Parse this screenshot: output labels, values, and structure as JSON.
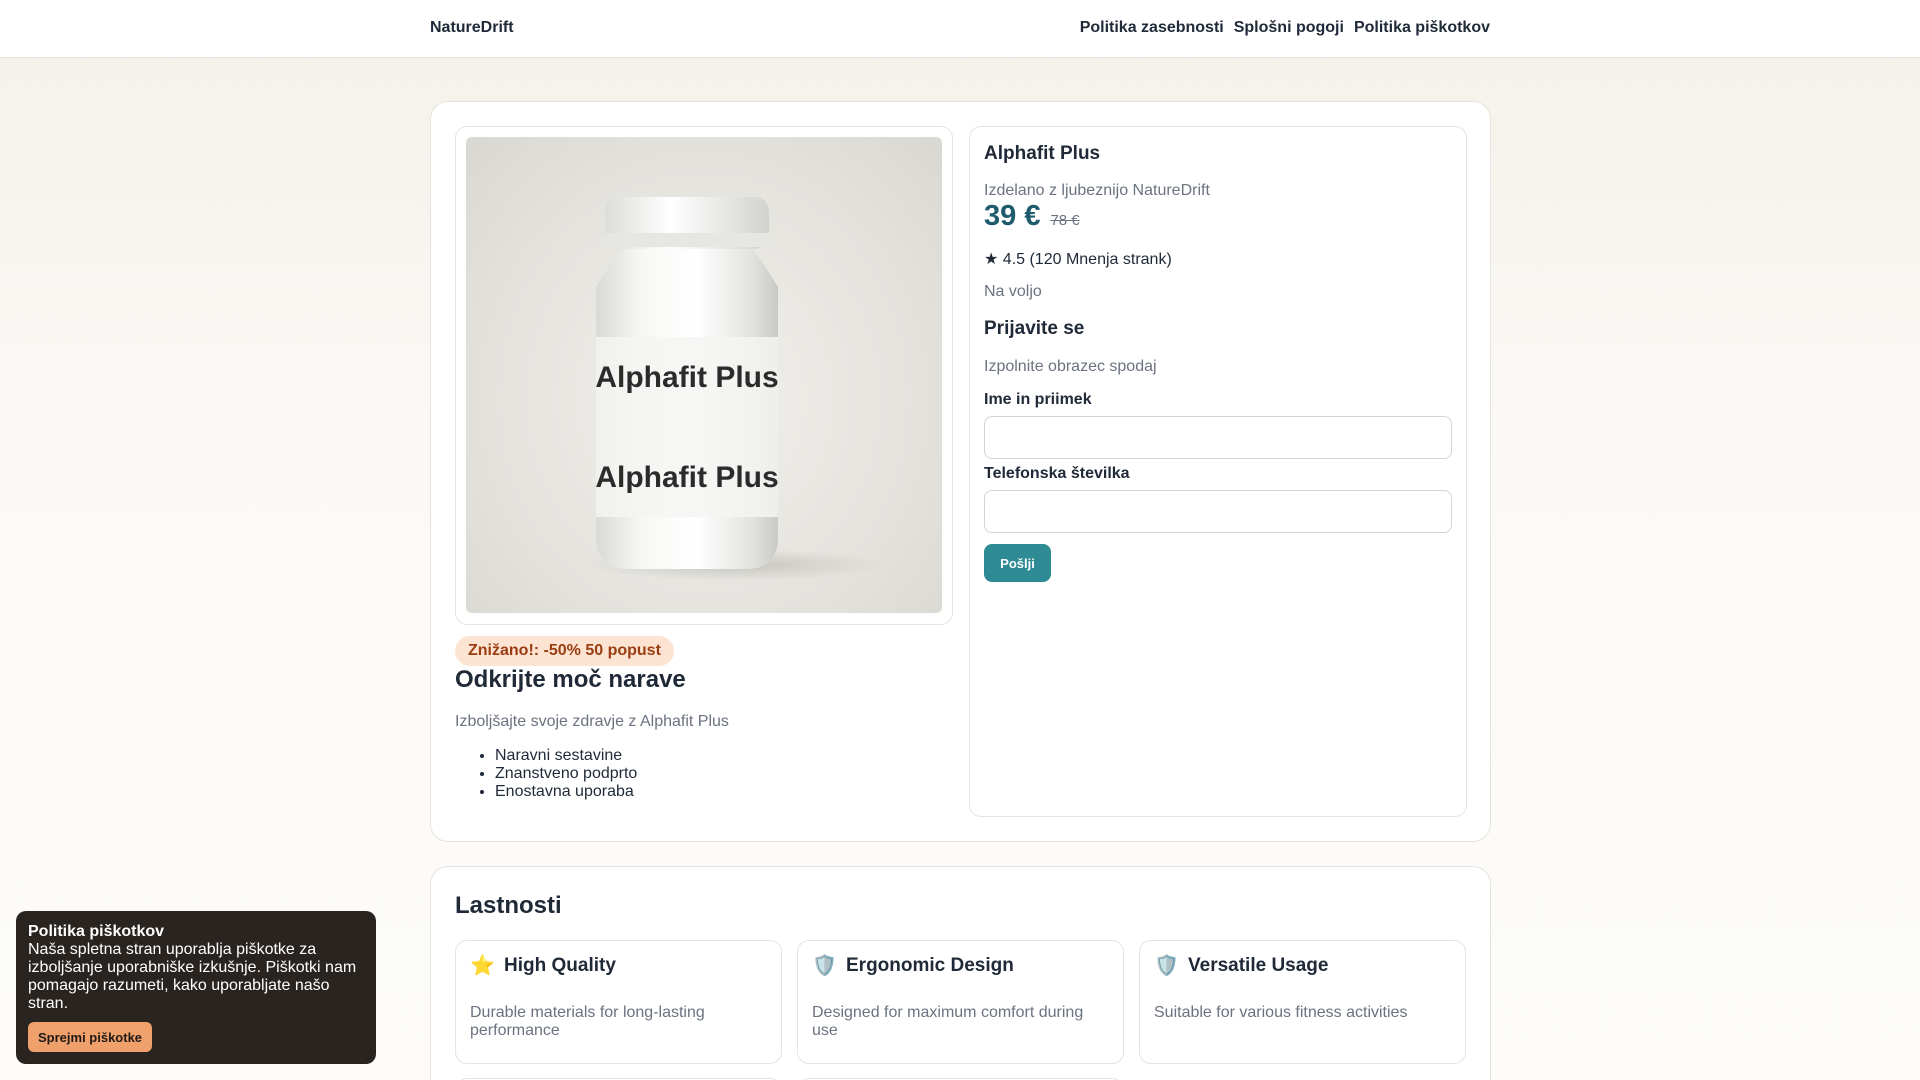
{
  "header": {
    "brand": "NatureDrift",
    "nav": [
      "Politika zasebnosti",
      "Splošni pogoji",
      "Politika piškotkov"
    ]
  },
  "hero": {
    "image_label": "Alphafit Plus",
    "discount_badge": "Znižano!: -50% 50 popust",
    "title": "Odkrijte moč narave",
    "subtitle": "Izboljšajte svoje zdravje z Alphafit Plus",
    "bullets": [
      "Naravni sestavine",
      "Znanstveno podprto",
      "Enostavna uporaba"
    ]
  },
  "product": {
    "name": "Alphafit Plus",
    "made_by": "Izdelano z ljubeznijo NatureDrift",
    "price_new": "39 €",
    "price_old": "78 €",
    "rating": "★ 4.5 (120 Mnenja strank)",
    "stock": "Na voljo",
    "signup_title": "Prijavite se",
    "signup_hint": "Izpolnite obrazec spodaj",
    "name_label": "Ime in priimek",
    "name_value": "",
    "phone_label": "Telefonska številka",
    "phone_value": "",
    "submit_label": "Pošlji"
  },
  "features": {
    "title": "Lastnosti",
    "items": [
      {
        "icon": "star-icon",
        "glyph": "⭐",
        "name": "High Quality",
        "desc": "Durable materials for long-lasting performance"
      },
      {
        "icon": "shield-icon",
        "glyph": "🛡️",
        "name": "Ergonomic Design",
        "desc": "Designed for maximum comfort during use"
      },
      {
        "icon": "shield-icon",
        "glyph": "🛡️",
        "name": "Versatile Usage",
        "desc": "Suitable for various fitness activities"
      }
    ]
  },
  "cookie": {
    "title": "Politika piškotkov",
    "text": "Naša spletna stran uporablja piškotke za izboljšanje uporabniške izkušnje. Piškotki nam pomagajo razumeti, kako uporabljate našo stran.",
    "button": "Sprejmi piškotke"
  },
  "colors": {
    "accent": "#2e8b94",
    "price": "#1d5b6d",
    "badge_bg": "#fde3d2",
    "badge_text": "#9a3e12",
    "cookie_bg": "#2a2420",
    "cookie_button": "#f0a06a"
  }
}
